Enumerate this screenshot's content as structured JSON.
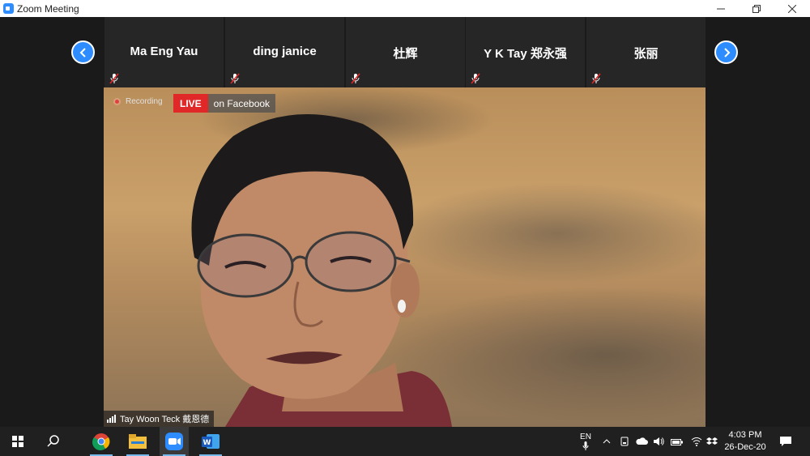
{
  "window": {
    "title": "Zoom Meeting",
    "controls": [
      "minimize",
      "restore",
      "close"
    ]
  },
  "gallery": {
    "participants": [
      {
        "name": "Ma Eng Yau",
        "muted": true
      },
      {
        "name": "ding janice",
        "muted": true
      },
      {
        "name": "杜辉",
        "muted": true
      },
      {
        "name": "Y K Tay 郑永强",
        "muted": true
      },
      {
        "name": "张丽",
        "muted": true
      }
    ]
  },
  "video": {
    "recording_label": "Recording",
    "live_label": "LIVE",
    "live_destination": "on Facebook",
    "speaker_name": "Tay Woon Teck 戴恩德"
  },
  "taskbar": {
    "apps": [
      "windows-start",
      "search",
      "chrome",
      "file-explorer",
      "zoom",
      "word"
    ],
    "language": "EN",
    "time": "4:03 PM",
    "date": "26-Dec-20"
  },
  "colors": {
    "zoom_blue": "#2d8cff",
    "live_red": "#e02828",
    "taskbar": "#202020"
  }
}
